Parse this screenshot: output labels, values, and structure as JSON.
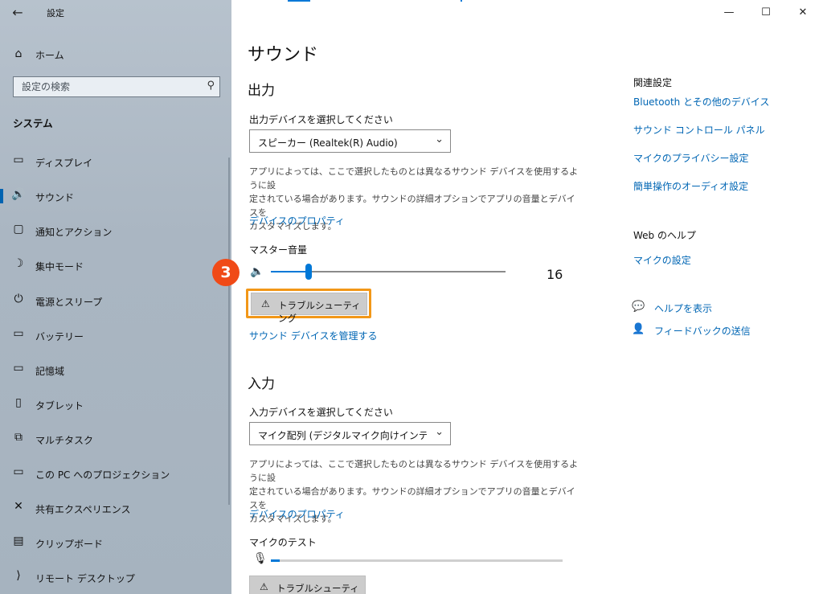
{
  "window": {
    "title": "設定",
    "back_icon": "back-arrow-icon"
  },
  "sidebar": {
    "home_label": "ホーム",
    "search_placeholder": "設定の検索",
    "section_title": "システム",
    "items": [
      {
        "label": "ディスプレイ",
        "icon": "display-icon",
        "glyph": "▭"
      },
      {
        "label": "サウンド",
        "icon": "speaker-icon",
        "glyph": "🔊",
        "active": true
      },
      {
        "label": "通知とアクション",
        "icon": "notification-icon",
        "glyph": "▢"
      },
      {
        "label": "集中モード",
        "icon": "moon-icon",
        "glyph": "☽"
      },
      {
        "label": "電源とスリープ",
        "icon": "power-icon",
        "glyph": "⏻"
      },
      {
        "label": "バッテリー",
        "icon": "battery-icon",
        "glyph": "▭"
      },
      {
        "label": "記憶域",
        "icon": "storage-icon",
        "glyph": "▭"
      },
      {
        "label": "タブレット",
        "icon": "tablet-icon",
        "glyph": "▯"
      },
      {
        "label": "マルチタスク",
        "icon": "multitask-icon",
        "glyph": "⧉"
      },
      {
        "label": "この PC へのプロジェクション",
        "icon": "projection-icon",
        "glyph": "▭"
      },
      {
        "label": "共有エクスペリエンス",
        "icon": "shared-icon",
        "glyph": "✕"
      },
      {
        "label": "クリップボード",
        "icon": "clipboard-icon",
        "glyph": "▤"
      },
      {
        "label": "リモート デスクトップ",
        "icon": "remote-desktop-icon",
        "glyph": "⟩"
      }
    ]
  },
  "main": {
    "title": "サウンド",
    "output": {
      "heading": "出力",
      "select_label": "出力デバイスを選択してください",
      "selected_device": "スピーカー (Realtek(R) Audio)",
      "description_1": "アプリによっては、ここで選択したものとは異なるサウンド デバイスを使用するように設",
      "description_2": "定されている場合があります。サウンドの詳細オプションでアプリの音量とデバイスを",
      "description_3": "カスタマイズします。",
      "device_properties": "デバイスのプロパティ",
      "master_volume_label": "マスター音量",
      "volume_value": "16",
      "volume_fraction": 0.16,
      "troubleshoot": "トラブルシューティング",
      "manage_devices": "サウンド デバイスを管理する"
    },
    "callout_number": "3",
    "input": {
      "heading": "入力",
      "select_label": "入力デバイスを選択してください",
      "selected_device": "マイク配列 (デジタルマイク向けインテル®...",
      "description_1": "アプリによっては、ここで選択したものとは異なるサウンド デバイスを使用するように設",
      "description_2": "定されている場合があります。サウンドの詳細オプションでアプリの音量とデバイスを",
      "description_3": "カスタマイズします。",
      "device_properties": "デバイスのプロパティ",
      "mic_test_label": "マイクのテスト",
      "mic_level_fraction": 0.03,
      "troubleshoot": "トラブルシューティング"
    }
  },
  "related": {
    "heading": "関連設定",
    "links": [
      "Bluetooth とその他のデバイス",
      "サウンド コントロール パネル",
      "マイクのプライバシー設定",
      "簡単操作のオーディオ設定"
    ],
    "web_help_heading": "Web のヘルプ",
    "web_help_link": "マイクの設定",
    "get_help": "ヘルプを表示",
    "feedback": "フィードバックの送信"
  },
  "colors": {
    "accent": "#0078d7",
    "link": "#0066b4",
    "callout": "#f04a17",
    "highlight": "#f29718"
  }
}
